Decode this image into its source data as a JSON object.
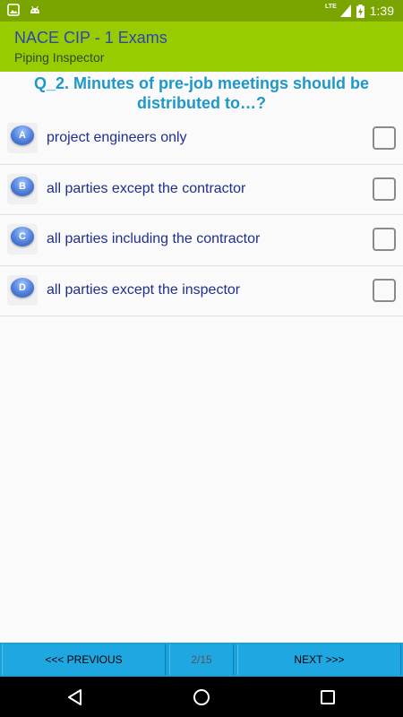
{
  "status_bar": {
    "time": "1:39",
    "network": "LTE",
    "icons": [
      "image-notification-icon",
      "android-notification-icon",
      "lte-signal-icon",
      "battery-charging-icon"
    ]
  },
  "app_bar": {
    "title": "NACE CIP - 1 Exams",
    "subtitle": "Piping Inspector"
  },
  "question": {
    "text": "Q_2. Minutes of pre-job meetings should be distributed to…?"
  },
  "options": [
    {
      "letter": "A",
      "text": "project engineers only",
      "checked": false
    },
    {
      "letter": "B",
      "text": "all parties except the contractor",
      "checked": false
    },
    {
      "letter": "C",
      "text": "all parties including the contractor",
      "checked": false
    },
    {
      "letter": "D",
      "text": "all parties except the inspector",
      "checked": false
    }
  ],
  "navigation": {
    "previous_label": "<<< PREVIOUS",
    "page_indicator": "2/15",
    "next_label": "NEXT >>>"
  },
  "colors": {
    "status_bar": "#7aa400",
    "app_bar": "#99cc00",
    "title_text": "#2d46b3",
    "question_text": "#1e98c9",
    "option_text": "#1f2f8f",
    "nav_bar": "#1ba0da"
  }
}
